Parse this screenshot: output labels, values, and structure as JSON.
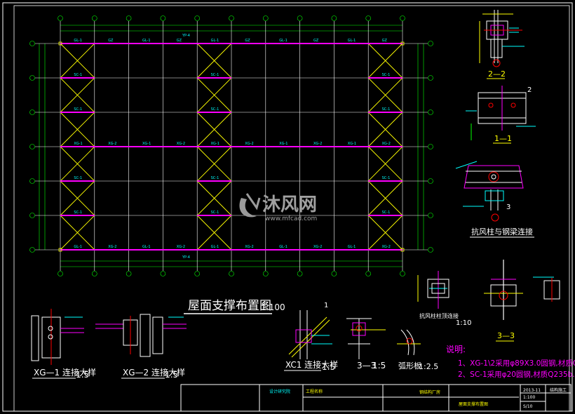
{
  "drawing": {
    "main_title": "屋面支撑布置图",
    "main_scale": "1:100",
    "grid_rows": [
      "Ⓐ",
      "Ⓑ",
      "Ⓒ",
      "Ⓓ",
      "Ⓔ",
      "Ⓕ",
      "Ⓖ"
    ],
    "bottom_axis_labels": [
      "①",
      "②",
      "③",
      "④",
      "⑤",
      "⑥",
      "⑦",
      "⑧",
      "⑨",
      "⑩",
      "⑪",
      "⑫",
      "⑬",
      "⑭",
      "⑮",
      "⑯",
      "⑰"
    ],
    "edge_labels": {
      "gz": "GZ",
      "gl": "GL-1",
      "xg1": "XG-1",
      "xg2": "XG-2",
      "sc": "SC-1",
      "yp": "YP-4"
    }
  },
  "details": {
    "sec_2_2": "2—2",
    "sec_1_1": "1—1",
    "sec_3_3": "3—3",
    "z_mark": "2",
    "wind_conn": "抗风柱与钢梁连接",
    "wind_top": "抗风柱柱顶连接",
    "xg1_title": "XG—1 连接大样",
    "xg1_scale": "1:5",
    "xg2_title": "XG—2 连接大样",
    "xg2_scale": "1:5",
    "xc1_title": "XC1 连接大样",
    "xc1_scale": "1:5",
    "s33_title": "3—3",
    "s33_scale": "1:5",
    "arc_title": "弧形板",
    "arc_scale": "1:2.5",
    "top_scale": "1:10",
    "one_mark": "1",
    "three_mark": "3"
  },
  "notes": {
    "heading": "说明:",
    "line1": "1、XG-1\\2采用φ89X3.0圆钢,材质Q235b.",
    "line2": "2、SC-1采用φ20圆钢,材质Q235b."
  },
  "watermark": {
    "brand": "沐风网",
    "url": "www.mfcad.com"
  },
  "title_block": {
    "design_unit": "设计研究院",
    "project": "工程名称",
    "project_name": "钢结构厂房",
    "drawing_name": "屋面支撑布置图",
    "scale": "1:100",
    "date": "2013-11",
    "sheet_no": "S/10",
    "sheet_code": "结构施工"
  },
  "colors": {
    "background": "#000000",
    "frame": "#ffffff",
    "grid": "#ffffff",
    "beam_magenta": "#ff00ff",
    "brace_yellow": "#ffff00",
    "axis_green": "#00ff00",
    "text_cyan": "#00ffff",
    "dim_yellow": "#ffff00",
    "red": "#ff0000",
    "note_magenta": "#ff00ff"
  }
}
